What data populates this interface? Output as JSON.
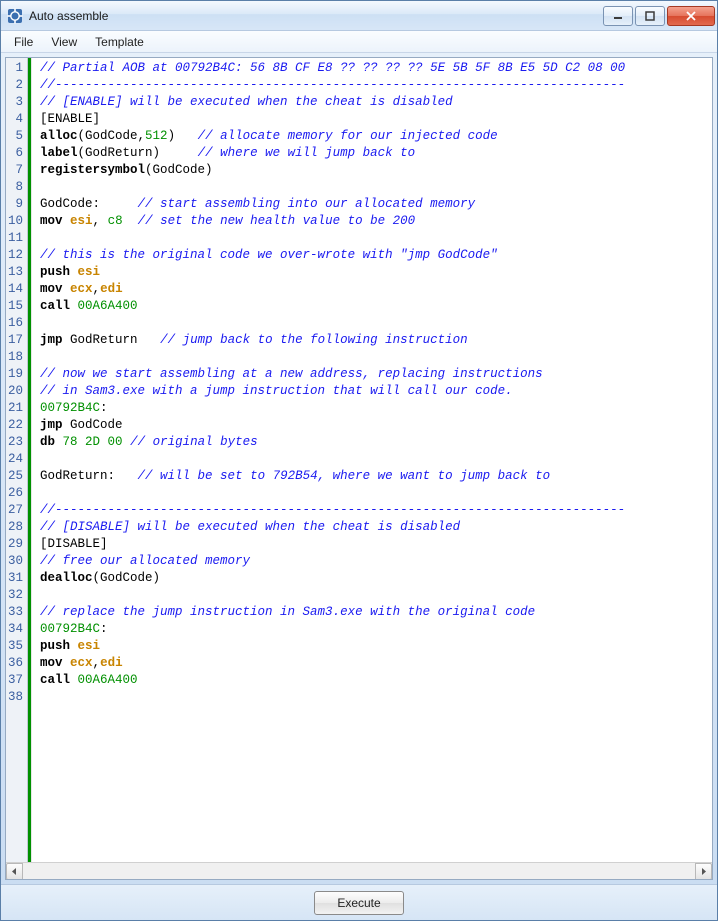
{
  "window": {
    "title": "Auto assemble"
  },
  "menu": {
    "file": "File",
    "view": "View",
    "template": "Template"
  },
  "footer": {
    "execute": "Execute"
  },
  "lines": [
    [
      [
        "c",
        "// Partial AOB at 00792B4C: 56 8B CF E8 ?? ?? ?? ?? 5E 5B 5F 8B E5 5D C2 08 00"
      ]
    ],
    [
      [
        "c",
        "//----------------------------------------------------------------------------"
      ]
    ],
    [
      [
        "c",
        "// [ENABLE] will be executed when the cheat is disabled"
      ]
    ],
    [
      [
        "p",
        "[ENABLE]"
      ]
    ],
    [
      [
        "k",
        "alloc"
      ],
      [
        "p",
        "(GodCode,"
      ],
      [
        "n",
        "512"
      ],
      [
        "p",
        ")   "
      ],
      [
        "c",
        "// allocate memory for our injected code"
      ]
    ],
    [
      [
        "k",
        "label"
      ],
      [
        "p",
        "(GodReturn)     "
      ],
      [
        "c",
        "// where we will jump back to"
      ]
    ],
    [
      [
        "k",
        "registersymbol"
      ],
      [
        "p",
        "(GodCode)"
      ]
    ],
    [
      [
        "p",
        ""
      ]
    ],
    [
      [
        "p",
        "GodCode:     "
      ],
      [
        "c",
        "// start assembling into our allocated memory"
      ]
    ],
    [
      [
        "k",
        "mov "
      ],
      [
        "r",
        "esi"
      ],
      [
        "p",
        ", "
      ],
      [
        "n",
        "c8"
      ],
      [
        "p",
        "  "
      ],
      [
        "c",
        "// set the new health value to be 200"
      ]
    ],
    [
      [
        "p",
        ""
      ]
    ],
    [
      [
        "c",
        "// this is the original code we over-wrote with \"jmp GodCode\""
      ]
    ],
    [
      [
        "k",
        "push "
      ],
      [
        "r",
        "esi"
      ]
    ],
    [
      [
        "k",
        "mov "
      ],
      [
        "r",
        "ecx"
      ],
      [
        "p",
        ","
      ],
      [
        "r",
        "edi"
      ]
    ],
    [
      [
        "k",
        "call "
      ],
      [
        "n",
        "00A6A400"
      ]
    ],
    [
      [
        "p",
        ""
      ]
    ],
    [
      [
        "k",
        "jmp"
      ],
      [
        "p",
        " GodReturn   "
      ],
      [
        "c",
        "// jump back to the following instruction"
      ]
    ],
    [
      [
        "p",
        ""
      ]
    ],
    [
      [
        "c",
        "// now we start assembling at a new address, replacing instructions"
      ]
    ],
    [
      [
        "c",
        "// in Sam3.exe with a jump instruction that will call our code."
      ]
    ],
    [
      [
        "n",
        "00792B4C"
      ],
      [
        "p",
        ":"
      ]
    ],
    [
      [
        "k",
        "jmp"
      ],
      [
        "p",
        " GodCode"
      ]
    ],
    [
      [
        "k",
        "db "
      ],
      [
        "n",
        "78 2D 00"
      ],
      [
        "p",
        " "
      ],
      [
        "c",
        "// original bytes"
      ]
    ],
    [
      [
        "p",
        ""
      ]
    ],
    [
      [
        "p",
        "GodReturn:   "
      ],
      [
        "c",
        "// will be set to 792B54, where we want to jump back to"
      ]
    ],
    [
      [
        "p",
        ""
      ]
    ],
    [
      [
        "c",
        "//----------------------------------------------------------------------------"
      ]
    ],
    [
      [
        "c",
        "// [DISABLE] will be executed when the cheat is disabled"
      ]
    ],
    [
      [
        "p",
        "[DISABLE]"
      ]
    ],
    [
      [
        "c",
        "// free our allocated memory"
      ]
    ],
    [
      [
        "k",
        "dealloc"
      ],
      [
        "p",
        "(GodCode)"
      ]
    ],
    [
      [
        "p",
        ""
      ]
    ],
    [
      [
        "c",
        "// replace the jump instruction in Sam3.exe with the original code"
      ]
    ],
    [
      [
        "n",
        "00792B4C"
      ],
      [
        "p",
        ":"
      ]
    ],
    [
      [
        "k",
        "push "
      ],
      [
        "r",
        "esi"
      ]
    ],
    [
      [
        "k",
        "mov "
      ],
      [
        "r",
        "ecx"
      ],
      [
        "p",
        ","
      ],
      [
        "r",
        "edi"
      ]
    ],
    [
      [
        "k",
        "call "
      ],
      [
        "n",
        "00A6A400"
      ]
    ],
    [
      [
        "p",
        ""
      ]
    ]
  ]
}
